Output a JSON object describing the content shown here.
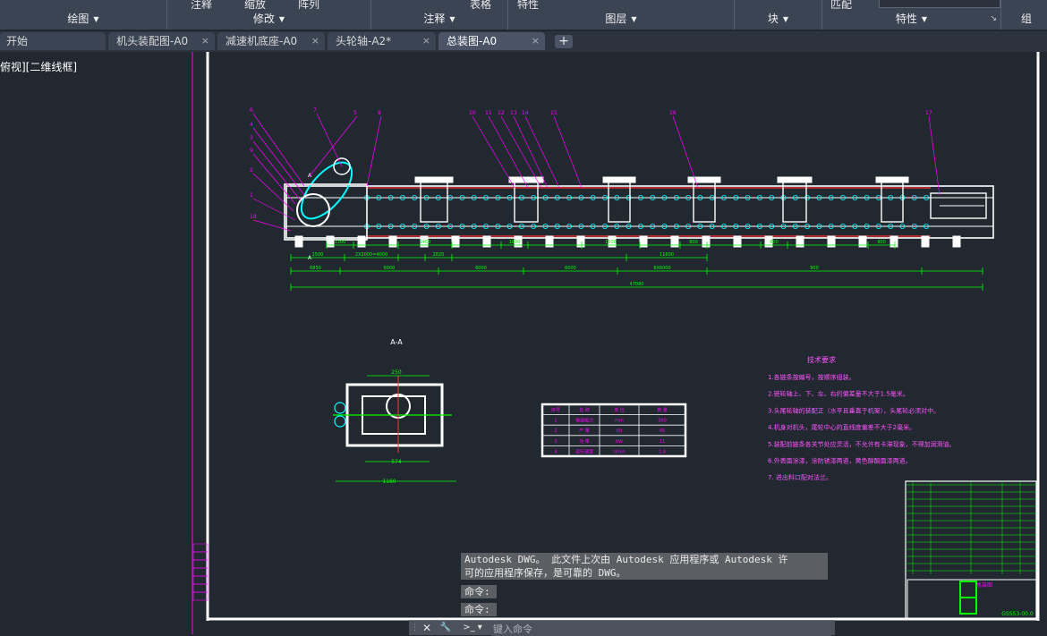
{
  "ribbon": {
    "top_fragments": [
      "注释",
      "缩放",
      "阵列",
      "表格",
      "特性",
      "匹配"
    ],
    "panels": [
      {
        "label": "绘图",
        "dropdown": true,
        "launcher": false
      },
      {
        "label": "修改",
        "dropdown": true,
        "launcher": false
      },
      {
        "label": "注释",
        "dropdown": true,
        "launcher": false
      },
      {
        "label": "图层",
        "dropdown": true,
        "launcher": false
      },
      {
        "label": "块",
        "dropdown": true,
        "launcher": false
      },
      {
        "label": "特性",
        "dropdown": true,
        "launcher": true
      },
      {
        "label": "组",
        "dropdown": false,
        "launcher": false
      }
    ]
  },
  "tabs": {
    "items": [
      {
        "label": "开始",
        "active": false,
        "closable": false
      },
      {
        "label": "机头装配图-A0",
        "active": false,
        "closable": true
      },
      {
        "label": "减速机底座-A0",
        "active": false,
        "closable": true
      },
      {
        "label": "头轮轴-A2*",
        "active": false,
        "closable": true
      },
      {
        "label": "总装图-A0",
        "active": true,
        "closable": true
      }
    ],
    "close_glyph": "×",
    "add_glyph": "+"
  },
  "viewport": {
    "label": "俯视][二维线框]"
  },
  "drawing": {
    "colors": {
      "frame": "#ffffff",
      "dimension": "#00ff00",
      "leader": "#ff00ff",
      "note_text": "#ff55ff",
      "belt": "#00ffff",
      "red": "#ff3333",
      "title_green": "#00ff00"
    },
    "callouts": [
      "6",
      "7",
      "5",
      "8",
      "4",
      "3",
      "9",
      "2",
      "1",
      "18",
      "10",
      "11",
      "12",
      "13",
      "14",
      "15",
      "16",
      "17"
    ],
    "section_label": "A-A",
    "section_mark": "A",
    "dimensions_top": [
      "1300",
      "1460",
      "1000",
      "1000",
      "800",
      "800",
      "900"
    ],
    "dimensions_mid": [
      "1500",
      "2X2000=4000",
      "2820",
      "11600"
    ],
    "dimensions_low": [
      "6850",
      "6000",
      "6000",
      "6000",
      "6X6000",
      "900"
    ],
    "dimension_total": "47080",
    "section_dims": [
      "250",
      "574",
      "1160"
    ],
    "spec_table": {
      "headers": [
        "序号",
        "名 称",
        "单 位",
        "数 量"
      ],
      "rows": [
        [
          "1",
          "输送能力",
          "mm",
          "500"
        ],
        [
          "2",
          "产 量",
          "t/h",
          "45"
        ],
        [
          "3",
          "功 率",
          "kW",
          "11"
        ],
        [
          "4",
          "运行速度",
          "r/min",
          "1.4"
        ]
      ]
    },
    "tech_notes": {
      "title": "技术要求",
      "items": [
        "1.各链条按编号，按顺序组装。",
        "2.链轮轴上、下、左、右的偏差量不大于1.5毫米。",
        "3.头尾轮轴的装配正（水平且垂直于机架），头尾轮必须对中。",
        "4.机身对机头，尾轮中心的直线度偏差不大于2毫米。",
        "5.装配前链条各关节处应灵活，不允许有卡滞现象，不得加润滑油。",
        "6.外表面涂漆，涂防锈漆两道，黄色醇酸面漆两道。",
        "7. 进出料口配对法兰。"
      ]
    },
    "title_block": {
      "name": "总装图",
      "code": "GSS53-00.0"
    }
  },
  "command_history": {
    "line1": "Autodesk DWG。  此文件上次由 Autodesk 应用程序或 Autodesk 许",
    "line2": "可的应用程序保存，是可靠的 DWG。",
    "prompt1": "命令:",
    "prompt2": "命令:"
  },
  "command_line": {
    "placeholder": "键入命令",
    "close_glyph": "✕",
    "settings_glyph": "🔧"
  }
}
